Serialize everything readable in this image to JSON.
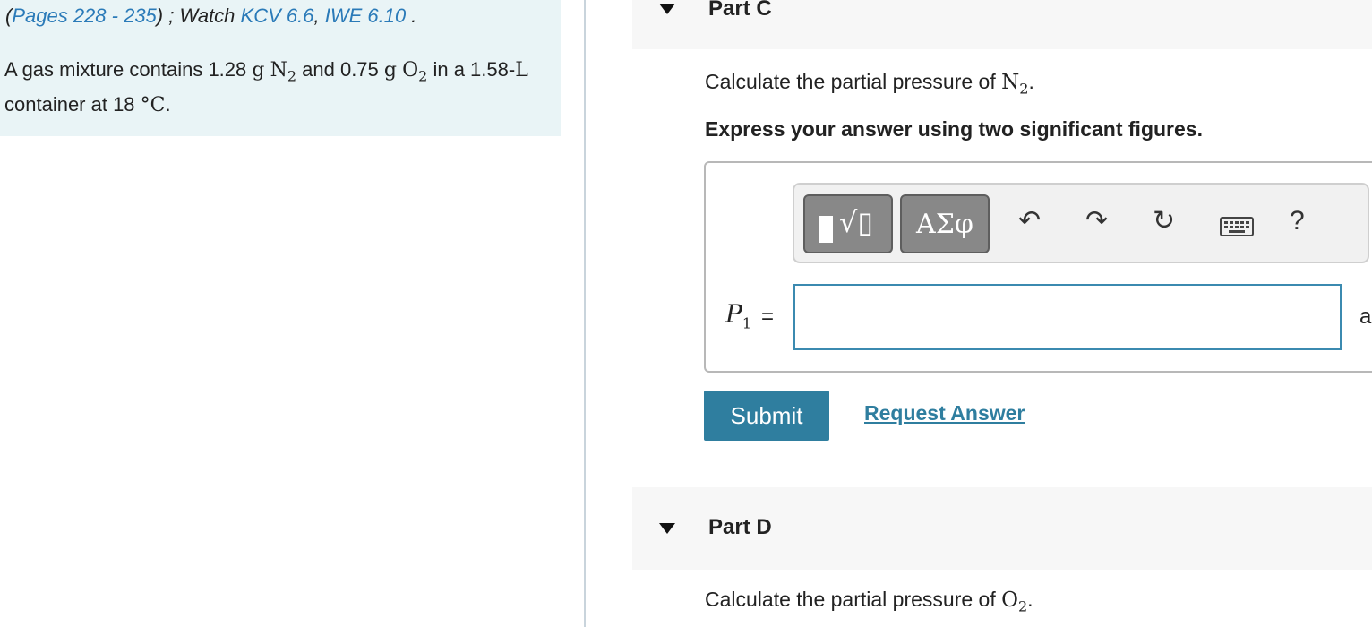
{
  "left": {
    "pages_open": "(",
    "pages_link": "Pages 228 - 235",
    "pages_close": ") ; Watch ",
    "kcv_link": "KCV 6.6",
    "sep": ", ",
    "iwe_link": "IWE 6.10",
    "period": " .",
    "problem": {
      "t1": "A gas mixture contains 1.28 ",
      "g1": "g",
      "n2": "N",
      "n2_sub": "2",
      "t2": " and 0.75 ",
      "g2": "g",
      "o2": "O",
      "o2_sub": "2",
      "t3": " in a 1.58-",
      "L": "L",
      "t4": " container at 18 ",
      "deg": "°C",
      "t5": "."
    }
  },
  "partC": {
    "title": "Part C",
    "prompt_prefix": "Calculate the partial pressure of ",
    "species": "N",
    "species_sub": "2",
    "prompt_suffix": ".",
    "instruction": "Express your answer using two significant figures.",
    "toolbar": {
      "templates_symbol": "√▯",
      "greek_label": "ΑΣφ",
      "undo": "↶",
      "redo": "↷",
      "reset": "↻",
      "help": "?"
    },
    "variable": "P",
    "variable_sub": "1",
    "equals": "=",
    "answer_value": "",
    "units_fragment": "a",
    "submit_label": "Submit",
    "request_label": "Request Answer"
  },
  "partD": {
    "title": "Part D",
    "prompt_prefix": "Calculate the partial pressure of ",
    "species": "O",
    "species_sub": "2",
    "prompt_suffix": "."
  }
}
